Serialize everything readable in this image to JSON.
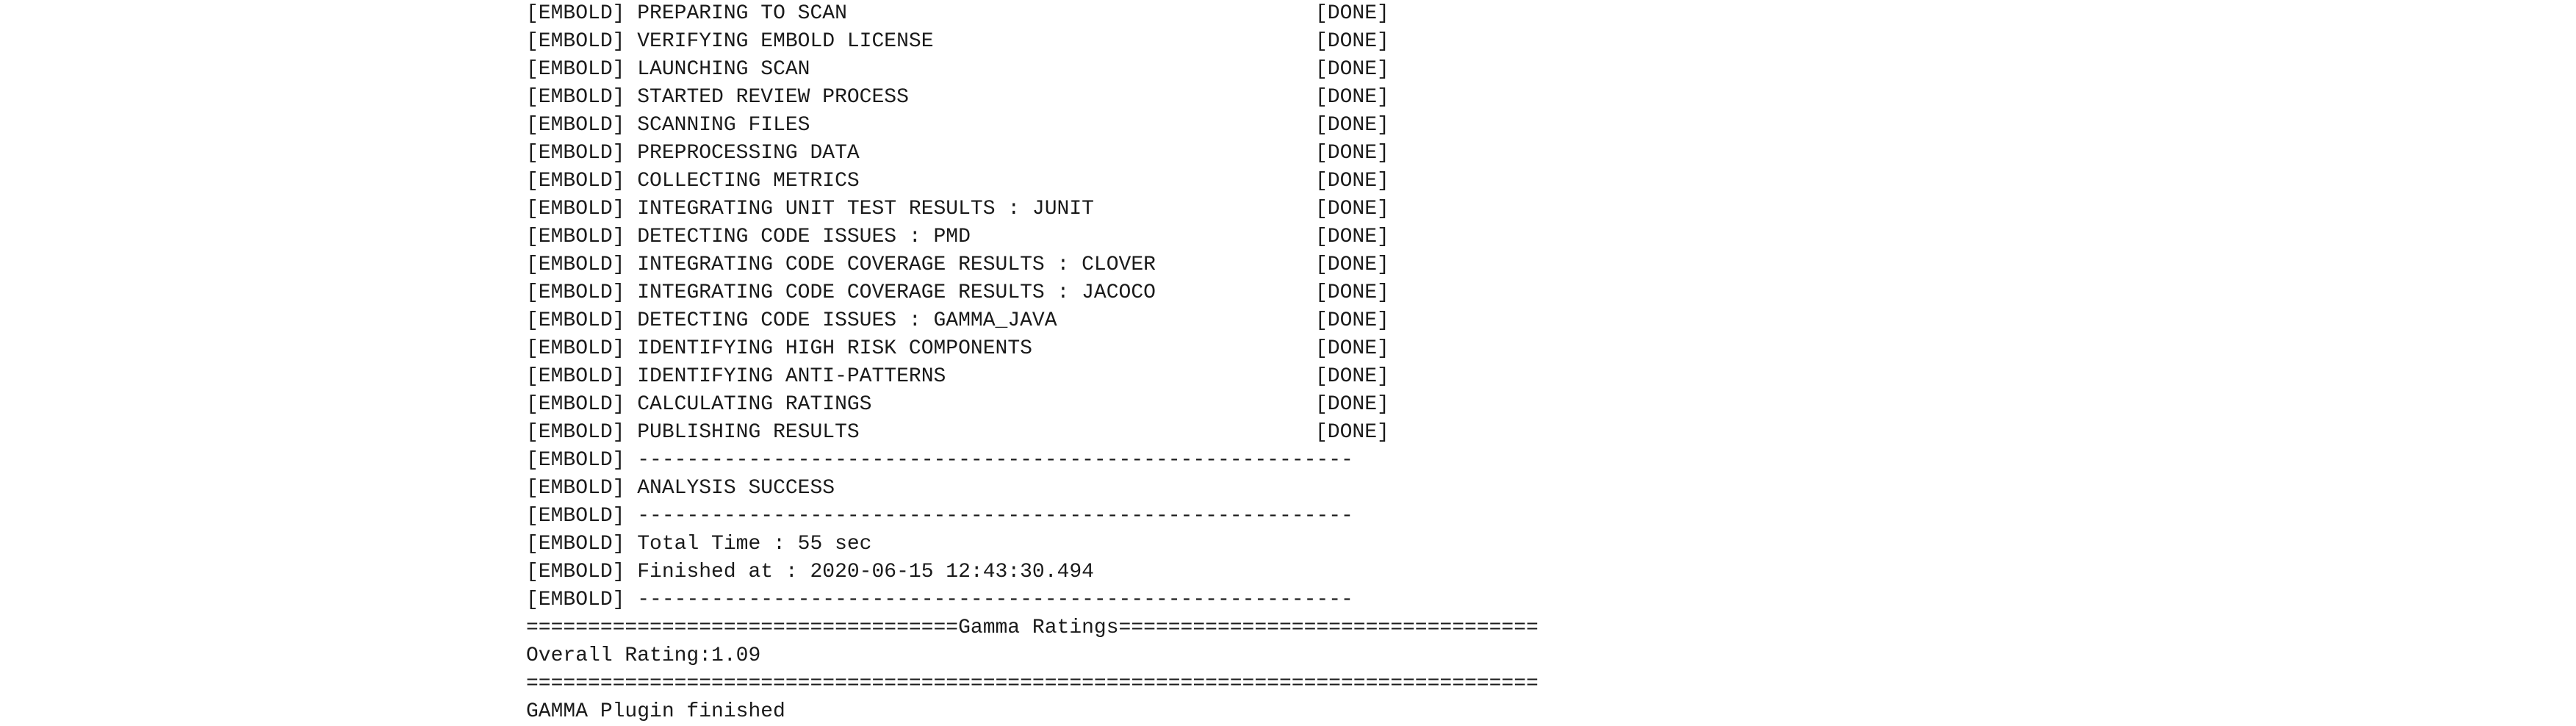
{
  "console": {
    "prefix": "[EMBOLD]",
    "steps": [
      {
        "message": "PREPARING TO SCAN",
        "status": "[DONE]"
      },
      {
        "message": "VERIFYING EMBOLD LICENSE",
        "status": "[DONE]"
      },
      {
        "message": "LAUNCHING SCAN",
        "status": "[DONE]"
      },
      {
        "message": "STARTED REVIEW PROCESS",
        "status": "[DONE]"
      },
      {
        "message": "SCANNING FILES",
        "status": "[DONE]"
      },
      {
        "message": "PREPROCESSING DATA",
        "status": "[DONE]"
      },
      {
        "message": "COLLECTING METRICS",
        "status": "[DONE]"
      },
      {
        "message": "INTEGRATING UNIT TEST RESULTS : JUNIT",
        "status": "[DONE]"
      },
      {
        "message": "DETECTING CODE ISSUES : PMD",
        "status": "[DONE]"
      },
      {
        "message": "INTEGRATING CODE COVERAGE RESULTS : CLOVER",
        "status": "[DONE]"
      },
      {
        "message": "INTEGRATING CODE COVERAGE RESULTS : JACOCO",
        "status": "[DONE]"
      },
      {
        "message": "DETECTING CODE ISSUES : GAMMA_JAVA",
        "status": "[DONE]"
      },
      {
        "message": "IDENTIFYING HIGH RISK COMPONENTS",
        "status": "[DONE]"
      },
      {
        "message": "IDENTIFYING ANTI-PATTERNS",
        "status": "[DONE]"
      },
      {
        "message": "CALCULATING RATINGS",
        "status": "[DONE]"
      },
      {
        "message": "PUBLISHING RESULTS",
        "status": "[DONE]"
      }
    ],
    "separator": "----------------------------------------------------------",
    "analysis_result": "ANALYSIS SUCCESS",
    "total_time": "Total Time : 55 sec",
    "finished_at": "Finished at : 2020-06-15 12:43:30.494",
    "ratings_header": "===================================Gamma Ratings==================================",
    "overall_rating": "Overall Rating:1.09",
    "ratings_footer": "==================================================================================",
    "plugin_finished": "GAMMA Plugin finished"
  }
}
